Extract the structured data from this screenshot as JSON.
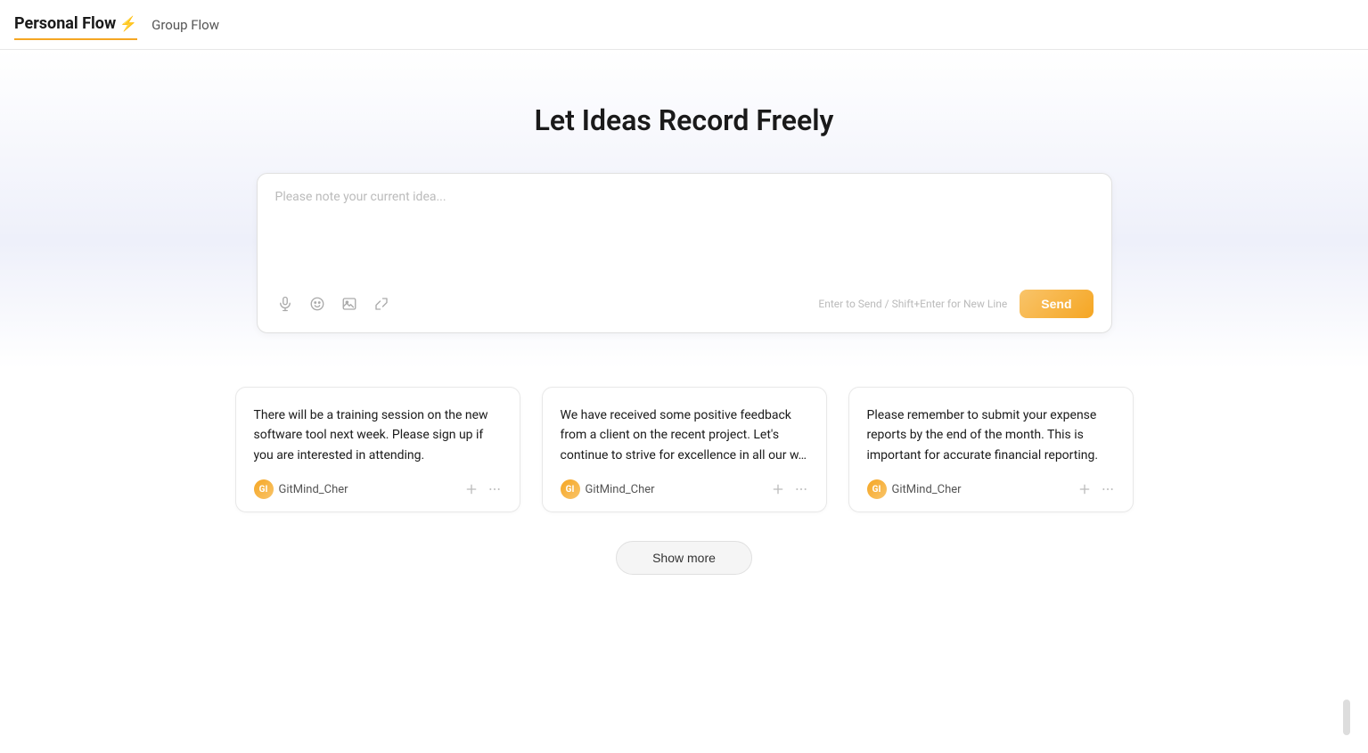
{
  "nav": {
    "personal_flow_label": "Personal Flow",
    "personal_flow_icon": "⚡",
    "group_flow_label": "Group Flow"
  },
  "hero": {
    "title": "Let Ideas Record Freely"
  },
  "input": {
    "placeholder": "Please note your current idea...",
    "shortcut_hint": "Enter to Send / Shift+Enter for New Line",
    "send_label": "Send"
  },
  "toolbar_icons": {
    "mic": "mic-icon",
    "emoji": "emoji-icon",
    "image": "image-icon",
    "expand": "expand-icon"
  },
  "cards": [
    {
      "text": "There will be a training session on the new software tool next week. Please sign up if you are interested in attending.",
      "author": "GitMind_Cher"
    },
    {
      "text": "We have received some positive feedback from a client on the recent project. Let's continue to strive for excellence in all our w…",
      "author": "GitMind_Cher"
    },
    {
      "text": "Please remember to submit your expense reports by the end of the month. This is important for accurate financial reporting.",
      "author": "GitMind_Cher"
    }
  ],
  "show_more": {
    "label": "Show more"
  }
}
